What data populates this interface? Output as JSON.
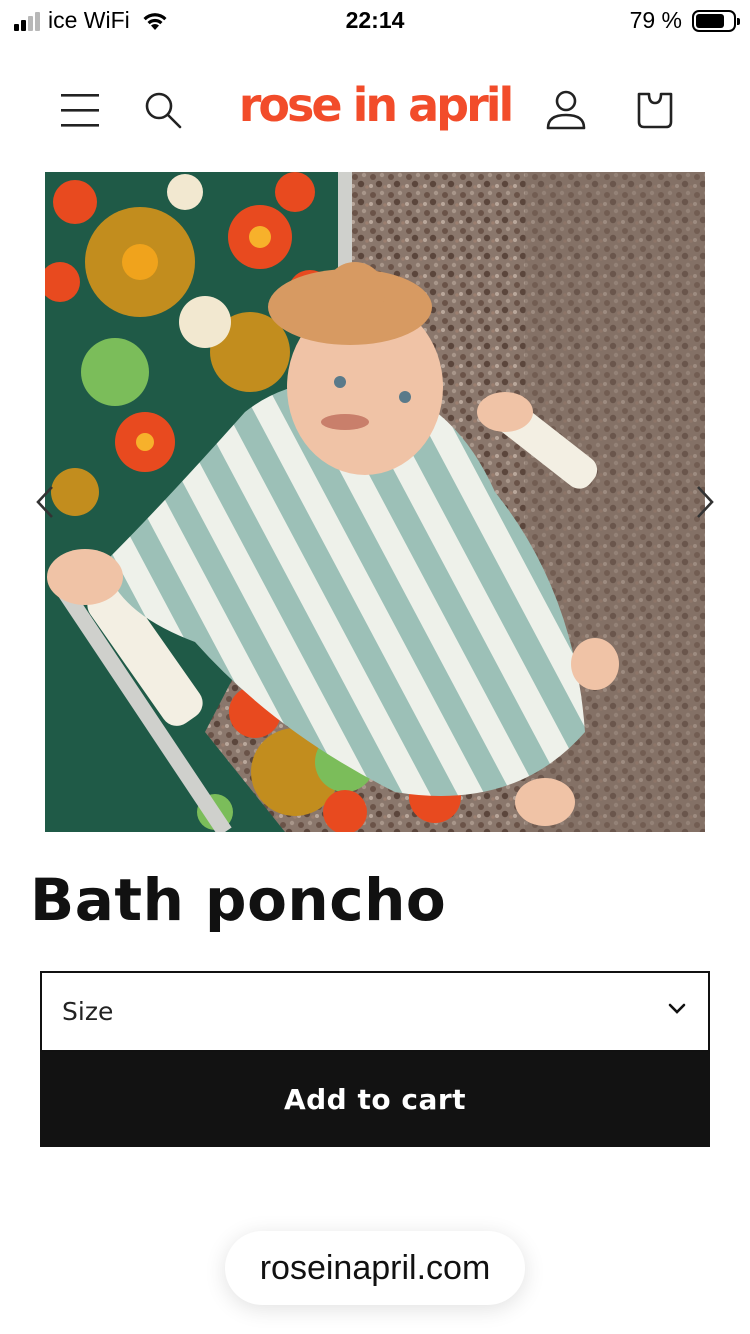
{
  "status_bar": {
    "carrier": "ice WiFi",
    "time": "22:14",
    "battery": "79 %",
    "battery_level": 0.79
  },
  "header": {
    "logo": "rose in april",
    "logo_color": "#f24c2a",
    "icons": [
      "menu-icon",
      "search-icon",
      "account-icon",
      "cart-icon"
    ]
  },
  "gallery": {
    "image_icon": "product-photo",
    "prev_icon": "chevron-left-icon",
    "next_icon": "chevron-right-icon"
  },
  "product": {
    "title": "Bath poncho",
    "size_label": "Size",
    "add_to_cart": "Add to cart"
  },
  "browser": {
    "url": "roseinapril.com"
  }
}
